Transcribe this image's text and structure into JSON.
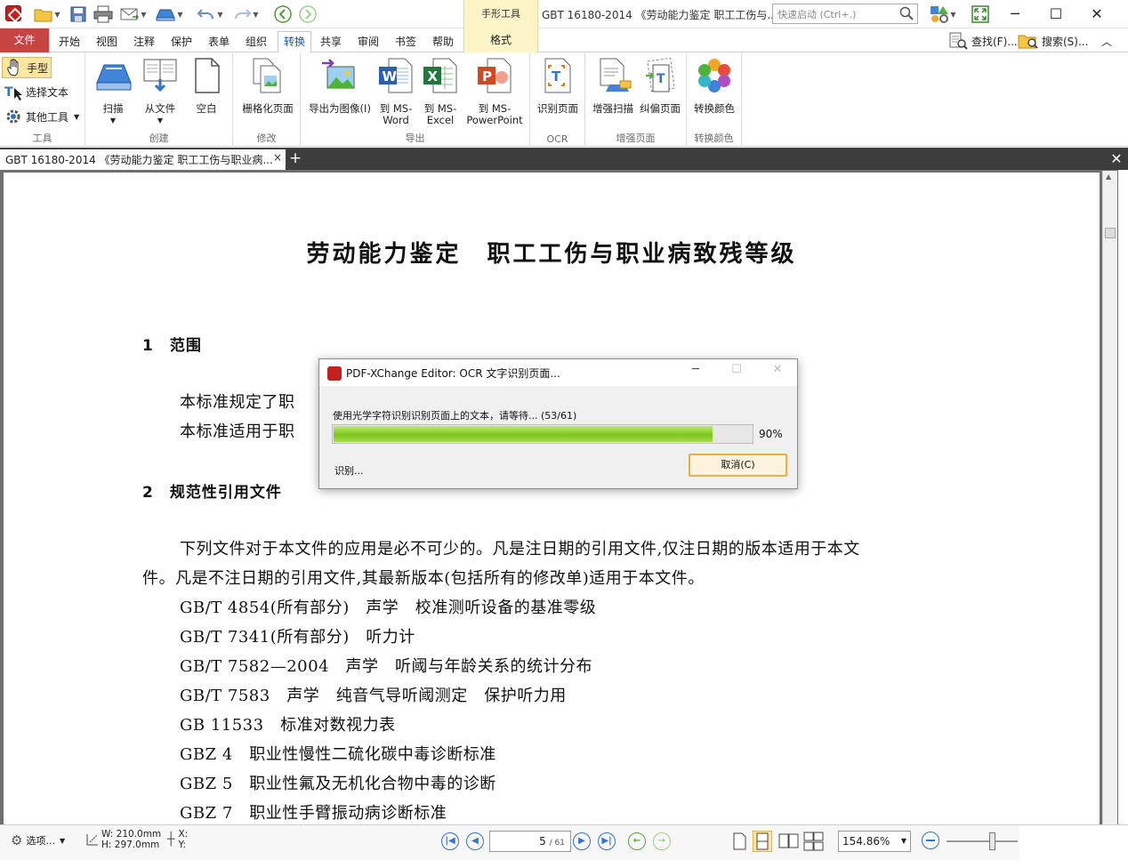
{
  "titlebar": {
    "context_tab": "手形工具",
    "window_title": "GBT 16180-2014 《劳动能力鉴定 职工工伤与...",
    "quick_launch_placeholder": "快速启动 (Ctrl+.)"
  },
  "ribbon_tabs": {
    "file": "文件",
    "tabs": [
      "开始",
      "视图",
      "注释",
      "保护",
      "表单",
      "组织",
      "转换",
      "共享",
      "审阅",
      "书签",
      "帮助"
    ],
    "active": "转换",
    "context_sub": "格式",
    "find": "查找(F)...",
    "search": "搜索(S)..."
  },
  "ribbon": {
    "tools": {
      "label": "工具",
      "hand": "手型",
      "select_text": "选择文本",
      "other_tools": "其他工具"
    },
    "create": {
      "label": "创建",
      "scan": "扫描",
      "from_file": "从文件",
      "blank": "空白"
    },
    "modify": {
      "label": "修改",
      "rasterize": "栅格化页面"
    },
    "export": {
      "label": "导出",
      "to_image": "导出为图像(I)",
      "to_word_1": "到 MS-",
      "to_word_2": "Word",
      "to_excel_1": "到 MS-",
      "to_excel_2": "Excel",
      "to_ppt_1": "到 MS-",
      "to_ppt_2": "PowerPoint"
    },
    "ocr": {
      "label": "OCR",
      "recognize": "识别页面"
    },
    "enhance": {
      "label": "增强页面",
      "enhance_scan": "增强扫描",
      "deskew": "纠偏页面"
    },
    "convert_colors": {
      "label": "转换颜色",
      "convert": "转换颜色"
    }
  },
  "doc_tab": {
    "title": "GBT 16180-2014 《劳动能力鉴定 职工工伤与职业病...",
    "close": "×",
    "plus": "+",
    "close_all": "✕"
  },
  "document": {
    "title": "劳动能力鉴定　职工工伤与职业病致残等级",
    "section1": "1　范围",
    "para1a": "本标准规定了职",
    "para1b": "本标准适用于职",
    "section2": "2　规范性引用文件",
    "para2a": "下列文件对于本文件的应用是必不可少的。凡是注日期的引用文件,仅注日期的版本适用于本文",
    "para2b": "件。凡是不注日期的引用文件,其最新版本(包括所有的修改单)适用于本文件。",
    "refs": [
      "GB/T 4854(所有部分)　声学　校准测听设备的基准零级",
      "GB/T 7341(所有部分)　听力计",
      "GB/T 7582—2004　声学　听阈与年龄关系的统计分布",
      "GB/T 7583　声学　纯音气导听阈测定　保护听力用",
      "GB 11533　标准对数视力表",
      "GBZ 4　职业性慢性二硫化碳中毒诊断标准",
      "GBZ 5　职业性氟及无机化合物中毒的诊断",
      "GBZ 7　职业性手臂振动病诊断标准"
    ]
  },
  "dialog": {
    "title": "PDF-XChange Editor: OCR 文字识别页面...",
    "message": "使用光学字符识别识别页面上的文本，请等待... (53/61)",
    "progress": 0.9,
    "percent": "90%",
    "status": "识别...",
    "cancel": "取消(C)"
  },
  "statusbar": {
    "options": "选项...",
    "width": "W: 210.0mm",
    "height": "H: 297.0mm",
    "x": "X:",
    "y": "Y:",
    "page": "5",
    "total": "/ 61",
    "zoom": "154.86%",
    "zoom_level": 0.6
  },
  "colors": {
    "file_tab": "#c64543",
    "accent_blue": "#3573c4",
    "context_tab": "#fdf4c8",
    "progress_green": "#7ec41e"
  }
}
